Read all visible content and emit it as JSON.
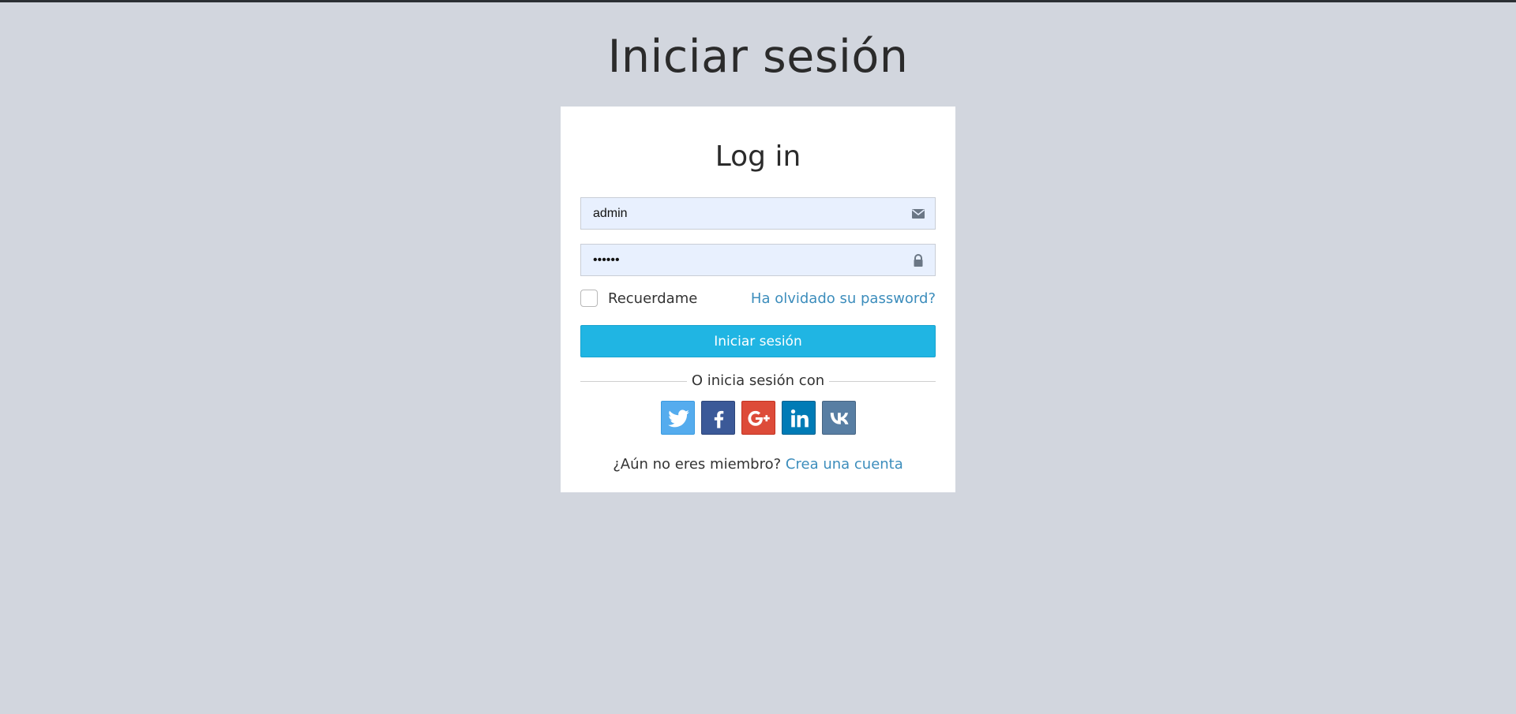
{
  "page": {
    "title": "Iniciar sesión"
  },
  "login": {
    "heading": "Log in",
    "username": {
      "value": "admin",
      "icon": "envelope-icon"
    },
    "password": {
      "value": "••••••",
      "icon": "lock-icon"
    },
    "remember_label": "Recuerdame",
    "remember_checked": false,
    "forgot_link": "Ha olvidado su password?",
    "submit_label": "Iniciar sesión",
    "divider_text": "O inicia sesión con",
    "social": [
      {
        "name": "twitter",
        "icon": "twitter-icon",
        "color": "#55acee"
      },
      {
        "name": "facebook",
        "icon": "facebook-icon",
        "color": "#3b5998"
      },
      {
        "name": "google-plus",
        "icon": "google-plus-icon",
        "color": "#dd4b39"
      },
      {
        "name": "linkedin",
        "icon": "linkedin-icon",
        "color": "#007bb6"
      },
      {
        "name": "vk",
        "icon": "vk-icon",
        "color": "#587ea3"
      }
    ],
    "signup_prompt": "¿Aún no eres miembro?",
    "signup_link": "Crea una cuenta"
  },
  "colors": {
    "background": "#d2d6de",
    "primary_button": "#20b5e3",
    "link": "#3c8dbc",
    "input_fill": "#e8f0fe"
  }
}
